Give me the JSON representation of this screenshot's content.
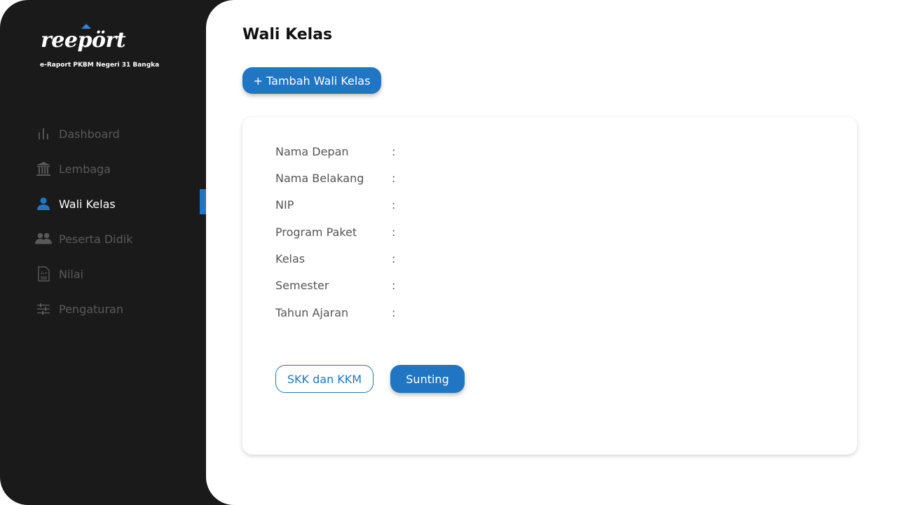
{
  "brand": {
    "logo_text": "reepört",
    "tagline": "e-Raport PKBM Negeri 31 Bangka"
  },
  "sidebar": {
    "items": [
      {
        "label": "Dashboard",
        "icon": "bar-chart-icon",
        "active": false
      },
      {
        "label": "Lembaga",
        "icon": "institution-icon",
        "active": false
      },
      {
        "label": "Wali Kelas",
        "icon": "user-icon",
        "active": true
      },
      {
        "label": "Peserta Didik",
        "icon": "users-icon",
        "active": false
      },
      {
        "label": "Nilai",
        "icon": "grade-document-icon",
        "active": false
      },
      {
        "label": "Pengaturan",
        "icon": "sliders-icon",
        "active": false
      }
    ]
  },
  "main": {
    "title": "Wali Kelas",
    "add_button_label": "+ Tambah Wali Kelas",
    "fields": [
      {
        "label": "Nama Depan",
        "separator": ":",
        "value": ""
      },
      {
        "label": "Nama Belakang",
        "separator": ":",
        "value": ""
      },
      {
        "label": "NIP",
        "separator": ":",
        "value": ""
      },
      {
        "label": "Program Paket",
        "separator": ":",
        "value": ""
      },
      {
        "label": "Kelas",
        "separator": ":",
        "value": ""
      },
      {
        "label": "Semester",
        "separator": ":",
        "value": ""
      },
      {
        "label": "Tahun Ajaran",
        "separator": ":",
        "value": ""
      }
    ],
    "skk_button_label": "SKK dan KKM",
    "edit_button_label": "Sunting"
  },
  "colors": {
    "sidebar_bg": "#1b1a1b",
    "accent": "#2176c4",
    "nav_inactive": "#5a595a",
    "nav_active": "#ffffff"
  }
}
